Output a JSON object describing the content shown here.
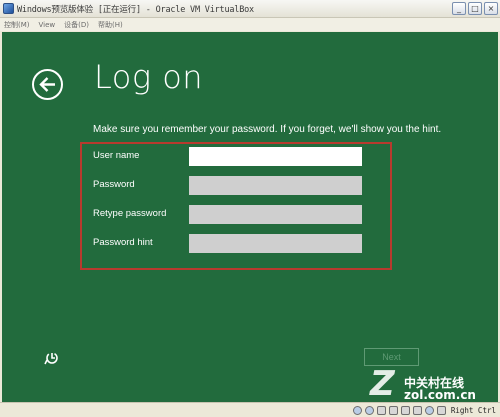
{
  "window": {
    "title": "Windows预览版体验 [正在运行] - Oracle VM VirtualBox",
    "minimize": "_",
    "maximize": "□",
    "close": "×"
  },
  "menu": {
    "items": [
      "控制(M)",
      "View",
      "设备(D)",
      "帮助(H)"
    ]
  },
  "screen": {
    "title": "Log on",
    "instructions": "Make sure you remember your password. If you forget, we'll show you the hint.",
    "fields": [
      {
        "label": "User name",
        "value": ""
      },
      {
        "label": "Password",
        "value": ""
      },
      {
        "label": "Retype password",
        "value": ""
      },
      {
        "label": "Password hint",
        "value": ""
      }
    ],
    "next_label": "Next",
    "background_color": "#226b3d",
    "highlight_color": "#b83a2e"
  },
  "watermark": {
    "logo": "Z",
    "brand": "中关村在线",
    "url": "zol.com.cn"
  },
  "statusbar": {
    "host_key": "Right Ctrl"
  }
}
